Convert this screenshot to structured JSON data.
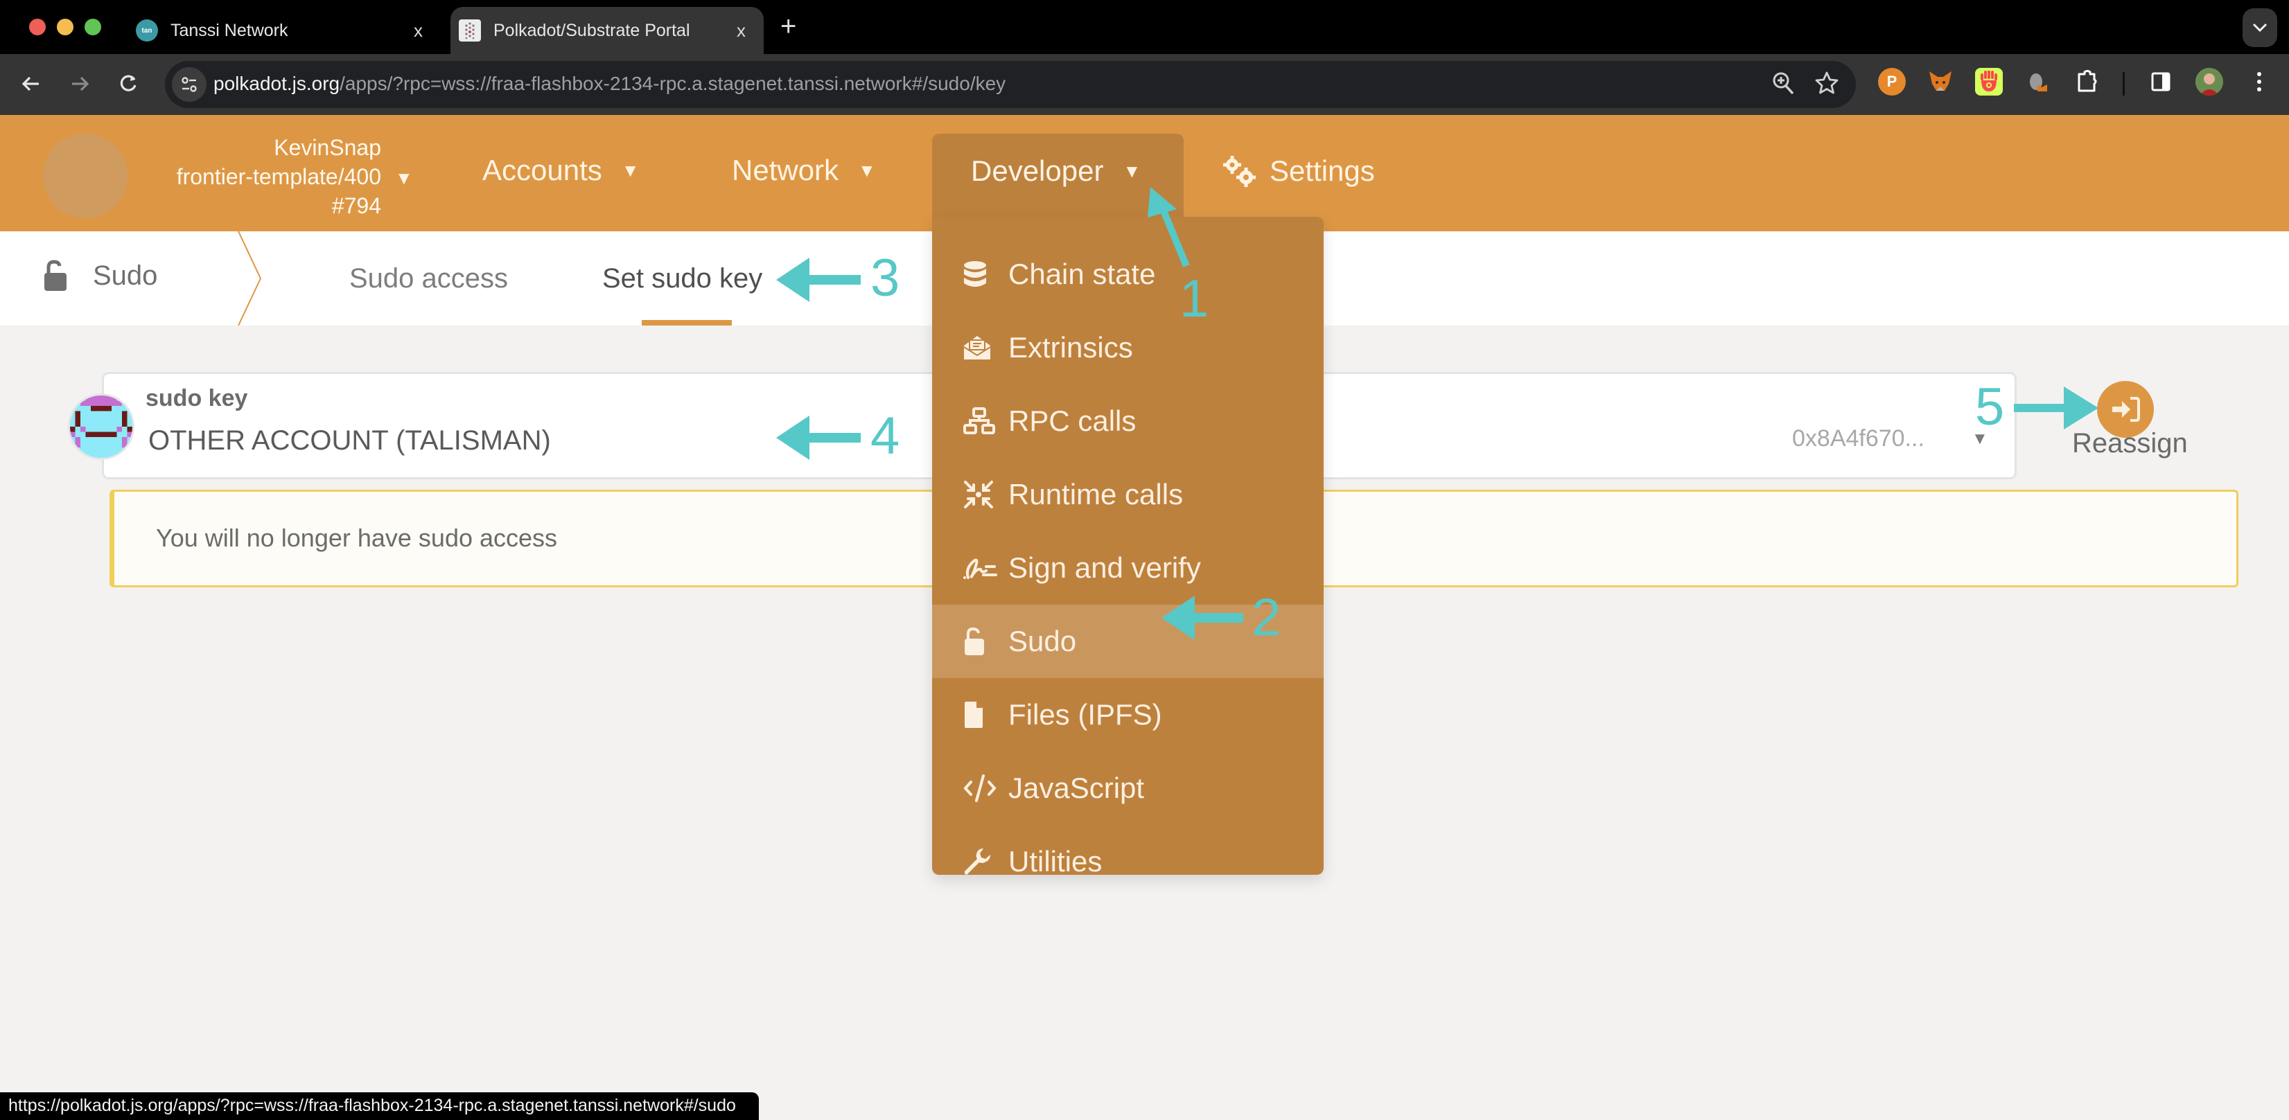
{
  "browser": {
    "tabs": [
      {
        "title": "Tanssi Network",
        "favicon": "tanssi-favicon",
        "active": false
      },
      {
        "title": "Polkadot/Substrate Portal",
        "favicon": "polkadot-favicon",
        "active": true
      }
    ],
    "new_tab_label": "+",
    "tab_close_label": "x",
    "tab_menu_label": "⌄",
    "url_host": "polkadot.js.org",
    "url_rest": "/apps/?rpc=wss://fraa-flashbox-2134-rpc.a.stagenet.tanssi.network#/sudo/key",
    "status_url": "https://polkadot.js.org/apps/?rpc=wss://fraa-flashbox-2134-rpc.a.stagenet.tanssi.network#/sudo",
    "extensions": [
      "polkadot-js-extension",
      "metamask",
      "talisman",
      "snap-extension",
      "extensions-puzzle"
    ]
  },
  "header": {
    "account_name": "KevinSnap",
    "chain_name": "frontier-template/400",
    "block_number": "#794",
    "nav": [
      {
        "label": "Accounts",
        "has_caret": true
      },
      {
        "label": "Network",
        "has_caret": true
      },
      {
        "label": "Developer",
        "has_caret": true,
        "open": true
      },
      {
        "label": "Settings",
        "icon": "gears-icon"
      }
    ]
  },
  "developer_menu": {
    "items": [
      {
        "label": "Chain state",
        "icon": "database-icon"
      },
      {
        "label": "Extrinsics",
        "icon": "envelope-open-icon"
      },
      {
        "label": "RPC calls",
        "icon": "network-icon"
      },
      {
        "label": "Runtime calls",
        "icon": "compress-arrows-icon"
      },
      {
        "label": "Sign and verify",
        "icon": "signature-icon"
      },
      {
        "label": "Sudo",
        "icon": "unlock-icon",
        "active": true
      },
      {
        "label": "Files (IPFS)",
        "icon": "file-icon"
      },
      {
        "label": "JavaScript",
        "icon": "code-icon"
      },
      {
        "label": "Utilities",
        "icon": "wrench-icon"
      }
    ]
  },
  "subnav": {
    "root_label": "Sudo",
    "tabs": [
      {
        "label": "Sudo access",
        "active": false
      },
      {
        "label": "Set sudo key",
        "active": true
      }
    ]
  },
  "sudo_key": {
    "label": "sudo key",
    "account_name": "OTHER ACCOUNT (TALISMAN)",
    "address": "0x8A4f670...",
    "action_label": "Reassign"
  },
  "warning": {
    "text": "You will no longer have sudo access"
  },
  "annotations": [
    "1",
    "2",
    "3",
    "4",
    "5"
  ],
  "colors": {
    "accent": "#dd9744",
    "menu_bg": "#bd813e",
    "menu_active": "#c9975e",
    "annotation": "#56c8c7",
    "warning_border": "#f1ce5a"
  }
}
